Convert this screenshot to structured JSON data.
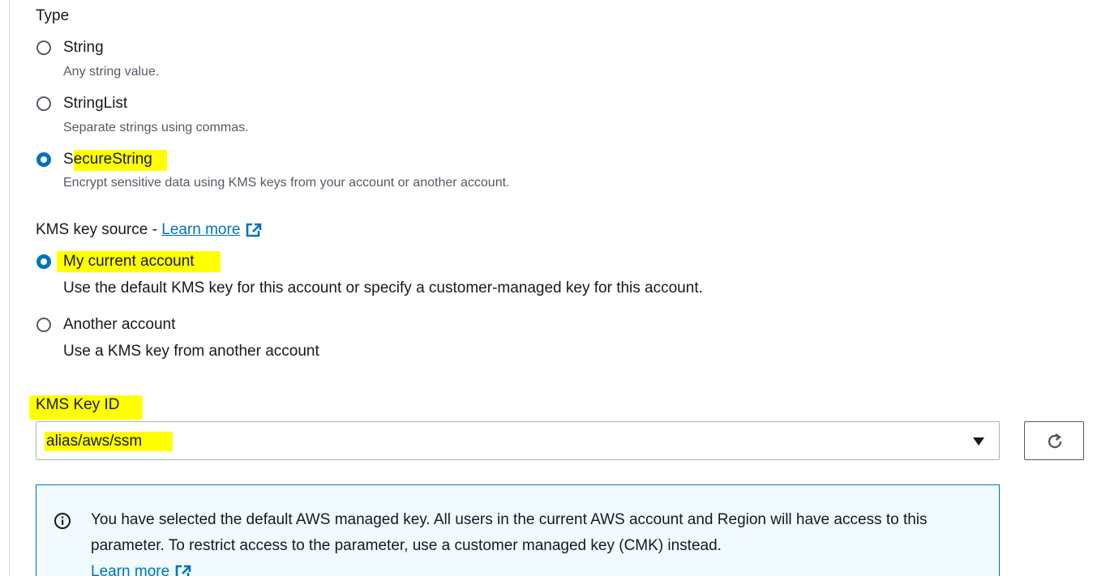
{
  "type_section": {
    "label": "Type",
    "options": [
      {
        "label": "String",
        "description": "Any string value.",
        "selected": false
      },
      {
        "label": "StringList",
        "description": "Separate strings using commas.",
        "selected": false
      },
      {
        "label_prefix": "S",
        "label_highlighted": "ecureString",
        "description": "Encrypt sensitive data using KMS keys from your account or another account.",
        "selected": true
      }
    ]
  },
  "kms_source": {
    "label": "KMS key source - ",
    "learn_more": "Learn more",
    "options": [
      {
        "label": "My current account",
        "description": "Use the default KMS key for this account or specify a customer-managed key for this account.",
        "selected": true
      },
      {
        "label": "Another account",
        "description": "Use a KMS key from another account",
        "selected": false
      }
    ]
  },
  "kms_key_id": {
    "label": "KMS Key ID",
    "selected_value": "alias/aws/ssm"
  },
  "info_alert": {
    "text": "You have selected the default AWS managed key. All users in the current AWS account and Region will have access to this parameter. To restrict access to the parameter, use a customer managed key (CMK) instead.",
    "learn_more": "Learn more"
  },
  "icons": {
    "external_link": "external-link-icon",
    "refresh": "refresh-icon",
    "info": "info-icon",
    "dropdown": "caret-down-icon"
  },
  "colors": {
    "accent": "#0073bb",
    "highlight": "#ffff00",
    "info_bg": "#f1faff",
    "text": "#16191f",
    "muted": "#545b64"
  }
}
